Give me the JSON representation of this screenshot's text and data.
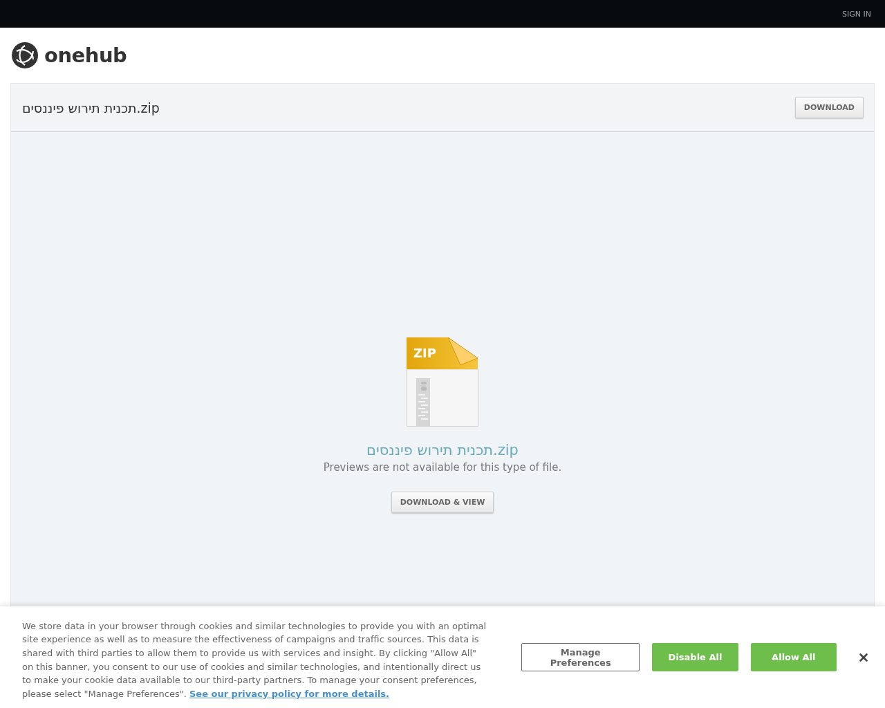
{
  "top_bar": {
    "sign_in": "SIGN IN"
  },
  "logo": {
    "text": "onehub"
  },
  "file_panel": {
    "title": "תכנית תירוש פיננסים.zip",
    "download_button": "DOWNLOAD"
  },
  "preview": {
    "file_type_label": "ZIP",
    "file_name": "תכנית תירוש פיננסים.zip",
    "message": "Previews are not available for this type of file.",
    "button": "DOWNLOAD & VIEW"
  },
  "cookie_banner": {
    "text": "We store data in your browser through cookies and similar technologies to provide you with an optimal site experience as well as to measure the effectiveness of campaigns and traffic sources. This data is shared with third parties to allow them to provide us with services and insight. By clicking \"Allow All\" on this banner, you consent to our use of cookies and similar technologies, and intentionally direct us to make your cookie data available to our third-party partners. To manage your consent preferences, please select \"Manage Preferences\".",
    "link": "See our privacy policy for more details.",
    "buttons": [
      {
        "label": "Manage Preferences",
        "kind": "outline"
      },
      {
        "label": "Disable All",
        "kind": "filled"
      },
      {
        "label": "Allow All",
        "kind": "filled"
      }
    ]
  }
}
